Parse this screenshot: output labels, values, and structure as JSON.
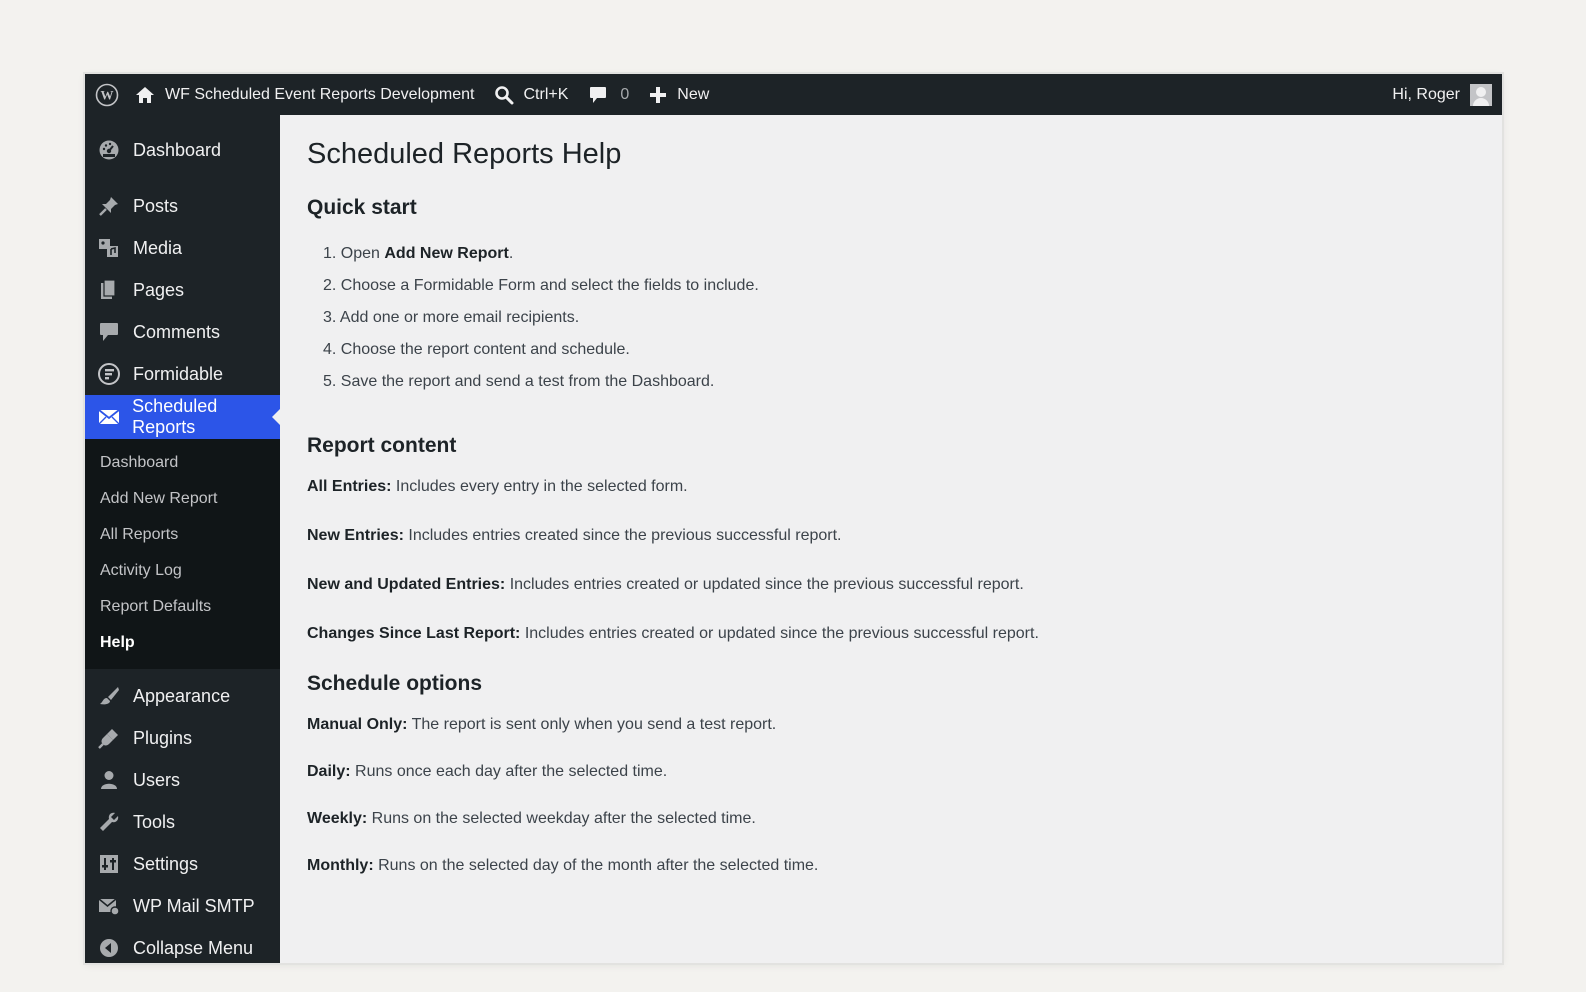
{
  "adminbar": {
    "site_name": "WF Scheduled Event Reports Development",
    "search_shortcut": "Ctrl+K",
    "comments_count": "0",
    "new_label": "New",
    "greeting": "Hi, Roger"
  },
  "sidebar": {
    "dashboard": "Dashboard",
    "posts": "Posts",
    "media": "Media",
    "pages": "Pages",
    "comments": "Comments",
    "formidable": "Formidable",
    "scheduled_reports": "Scheduled Reports",
    "submenu": [
      "Dashboard",
      "Add New Report",
      "All Reports",
      "Activity Log",
      "Report Defaults",
      "Help"
    ],
    "appearance": "Appearance",
    "plugins": "Plugins",
    "users": "Users",
    "tools": "Tools",
    "settings": "Settings",
    "wp_mail_smtp": "WP Mail SMTP",
    "collapse": "Collapse Menu"
  },
  "content": {
    "title": "Scheduled Reports Help",
    "quick_start": {
      "heading": "Quick start",
      "step1_prefix": "1. Open ",
      "step1_bold": "Add New Report",
      "step1_suffix": ".",
      "step2": "2. Choose a Formidable Form and select the fields to include.",
      "step3": "3. Add one or more email recipients.",
      "step4": "4. Choose the report content and schedule.",
      "step5": "5. Save the report and send a test from the Dashboard."
    },
    "report_content": {
      "heading": "Report content",
      "items": [
        {
          "term": "All Entries:",
          "desc": " Includes every entry in the selected form."
        },
        {
          "term": "New Entries:",
          "desc": " Includes entries created since the previous successful report."
        },
        {
          "term": "New and Updated Entries:",
          "desc": " Includes entries created or updated since the previous successful report."
        },
        {
          "term": "Changes Since Last Report:",
          "desc": " Includes entries created or updated since the previous successful report."
        }
      ]
    },
    "schedule_options": {
      "heading": "Schedule options",
      "items": [
        {
          "term": "Manual Only:",
          "desc": " The report is sent only when you send a test report."
        },
        {
          "term": "Daily:",
          "desc": " Runs once each day after the selected time."
        },
        {
          "term": "Weekly:",
          "desc": " Runs on the selected weekday after the selected time."
        },
        {
          "term": "Monthly:",
          "desc": " Runs on the selected day of the month after the selected time."
        }
      ]
    }
  },
  "colors": {
    "adminbar_bg": "#1d2327",
    "menu_current": "#2c55e8",
    "content_bg": "#f0f0f1"
  }
}
